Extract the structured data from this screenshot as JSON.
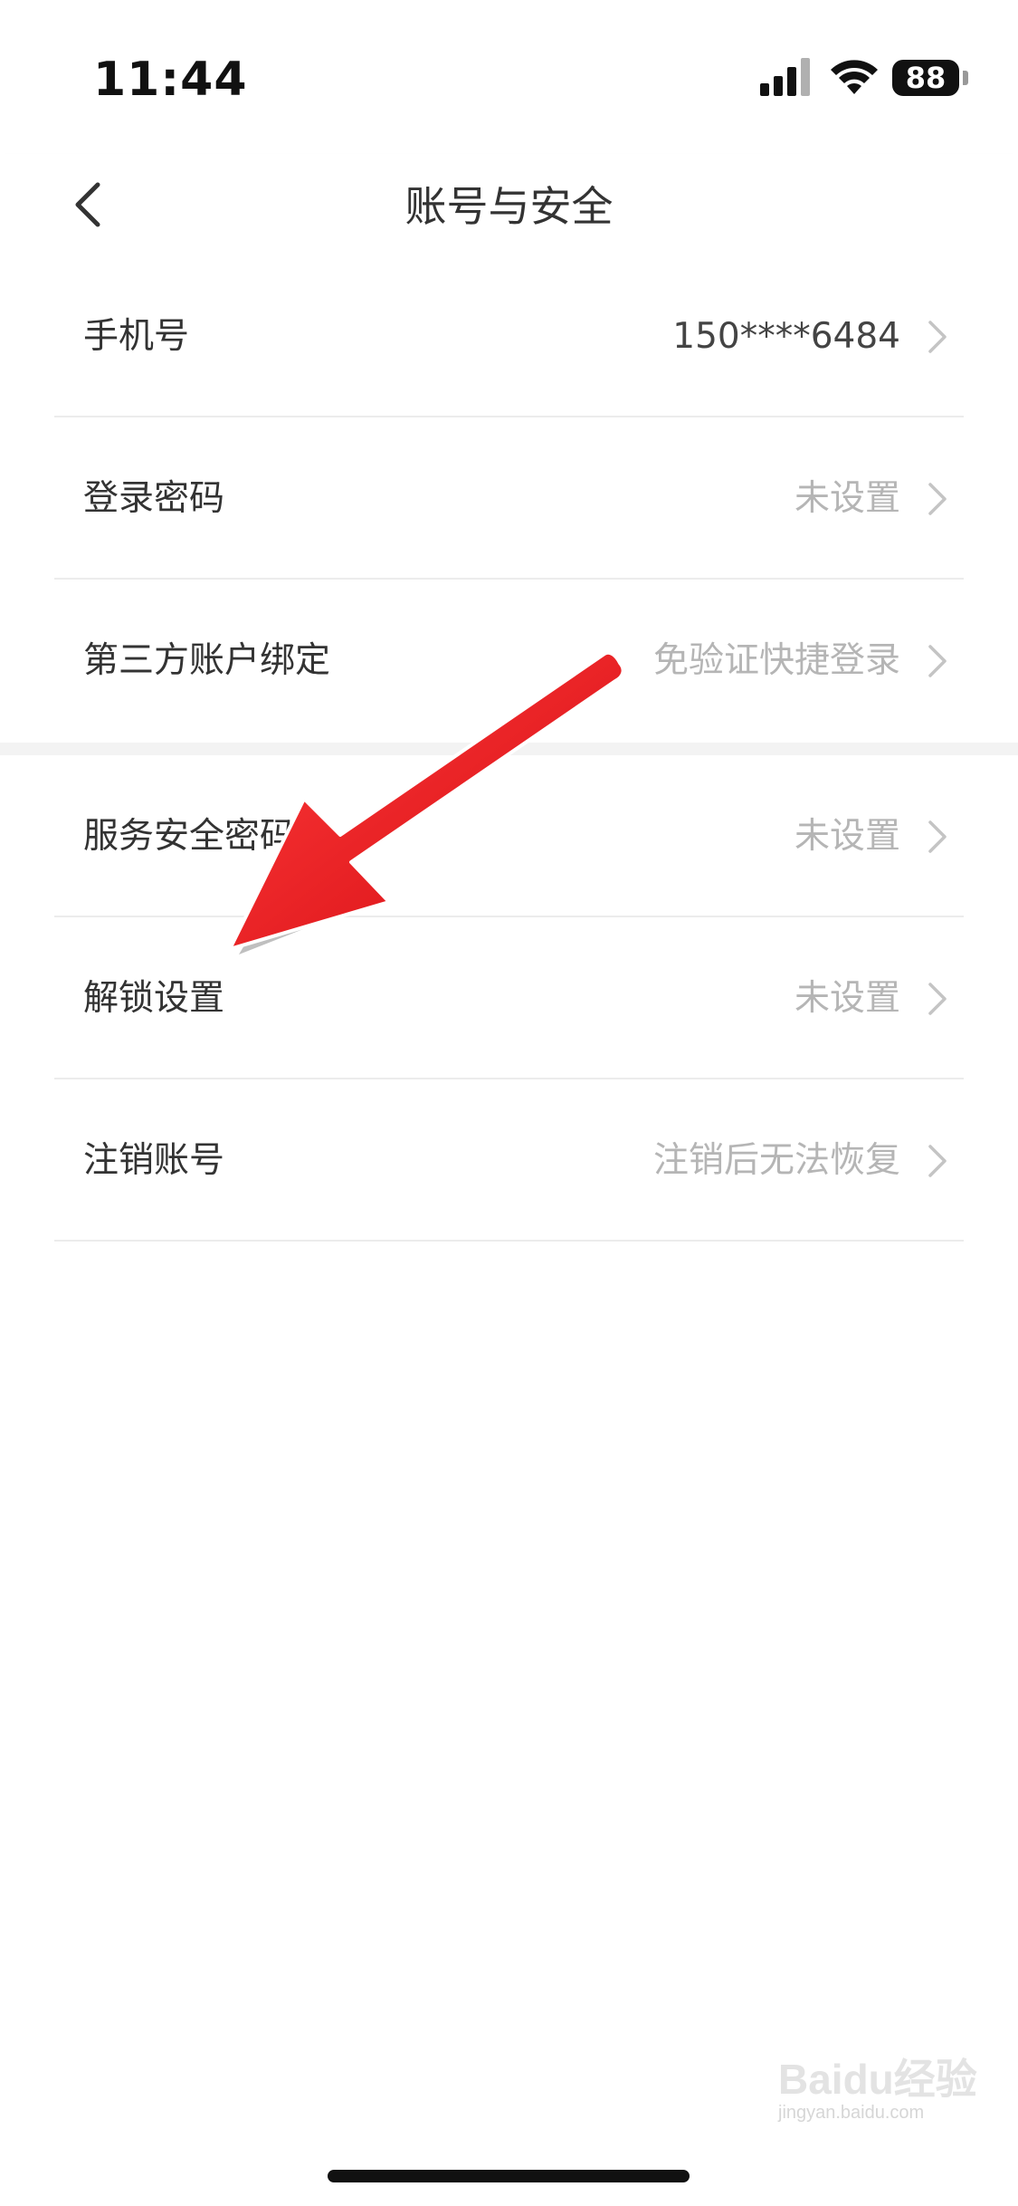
{
  "status_bar": {
    "time": "11:44",
    "battery": "88",
    "icons": [
      "signal-icon",
      "wifi-icon",
      "battery-icon"
    ]
  },
  "nav": {
    "title": "账号与安全",
    "back_icon": "chevron-left-icon"
  },
  "sections": [
    {
      "items": [
        {
          "label": "手机号",
          "value": "150****6484"
        },
        {
          "label": "登录密码",
          "value": "未设置"
        },
        {
          "label": "第三方账户绑定",
          "value": "免验证快捷登录"
        }
      ]
    },
    {
      "items": [
        {
          "label": "服务安全密码",
          "value": "未设置"
        },
        {
          "label": "解锁设置",
          "value": "未设置"
        },
        {
          "label": "注销账号",
          "value": "注销后无法恢复"
        }
      ]
    }
  ],
  "annotation": {
    "type": "red-arrow",
    "color": "#e8151b",
    "points_to": "解锁设置"
  },
  "watermark": {
    "text": "Baidu经验",
    "sub": "jingyan.baidu.com"
  }
}
